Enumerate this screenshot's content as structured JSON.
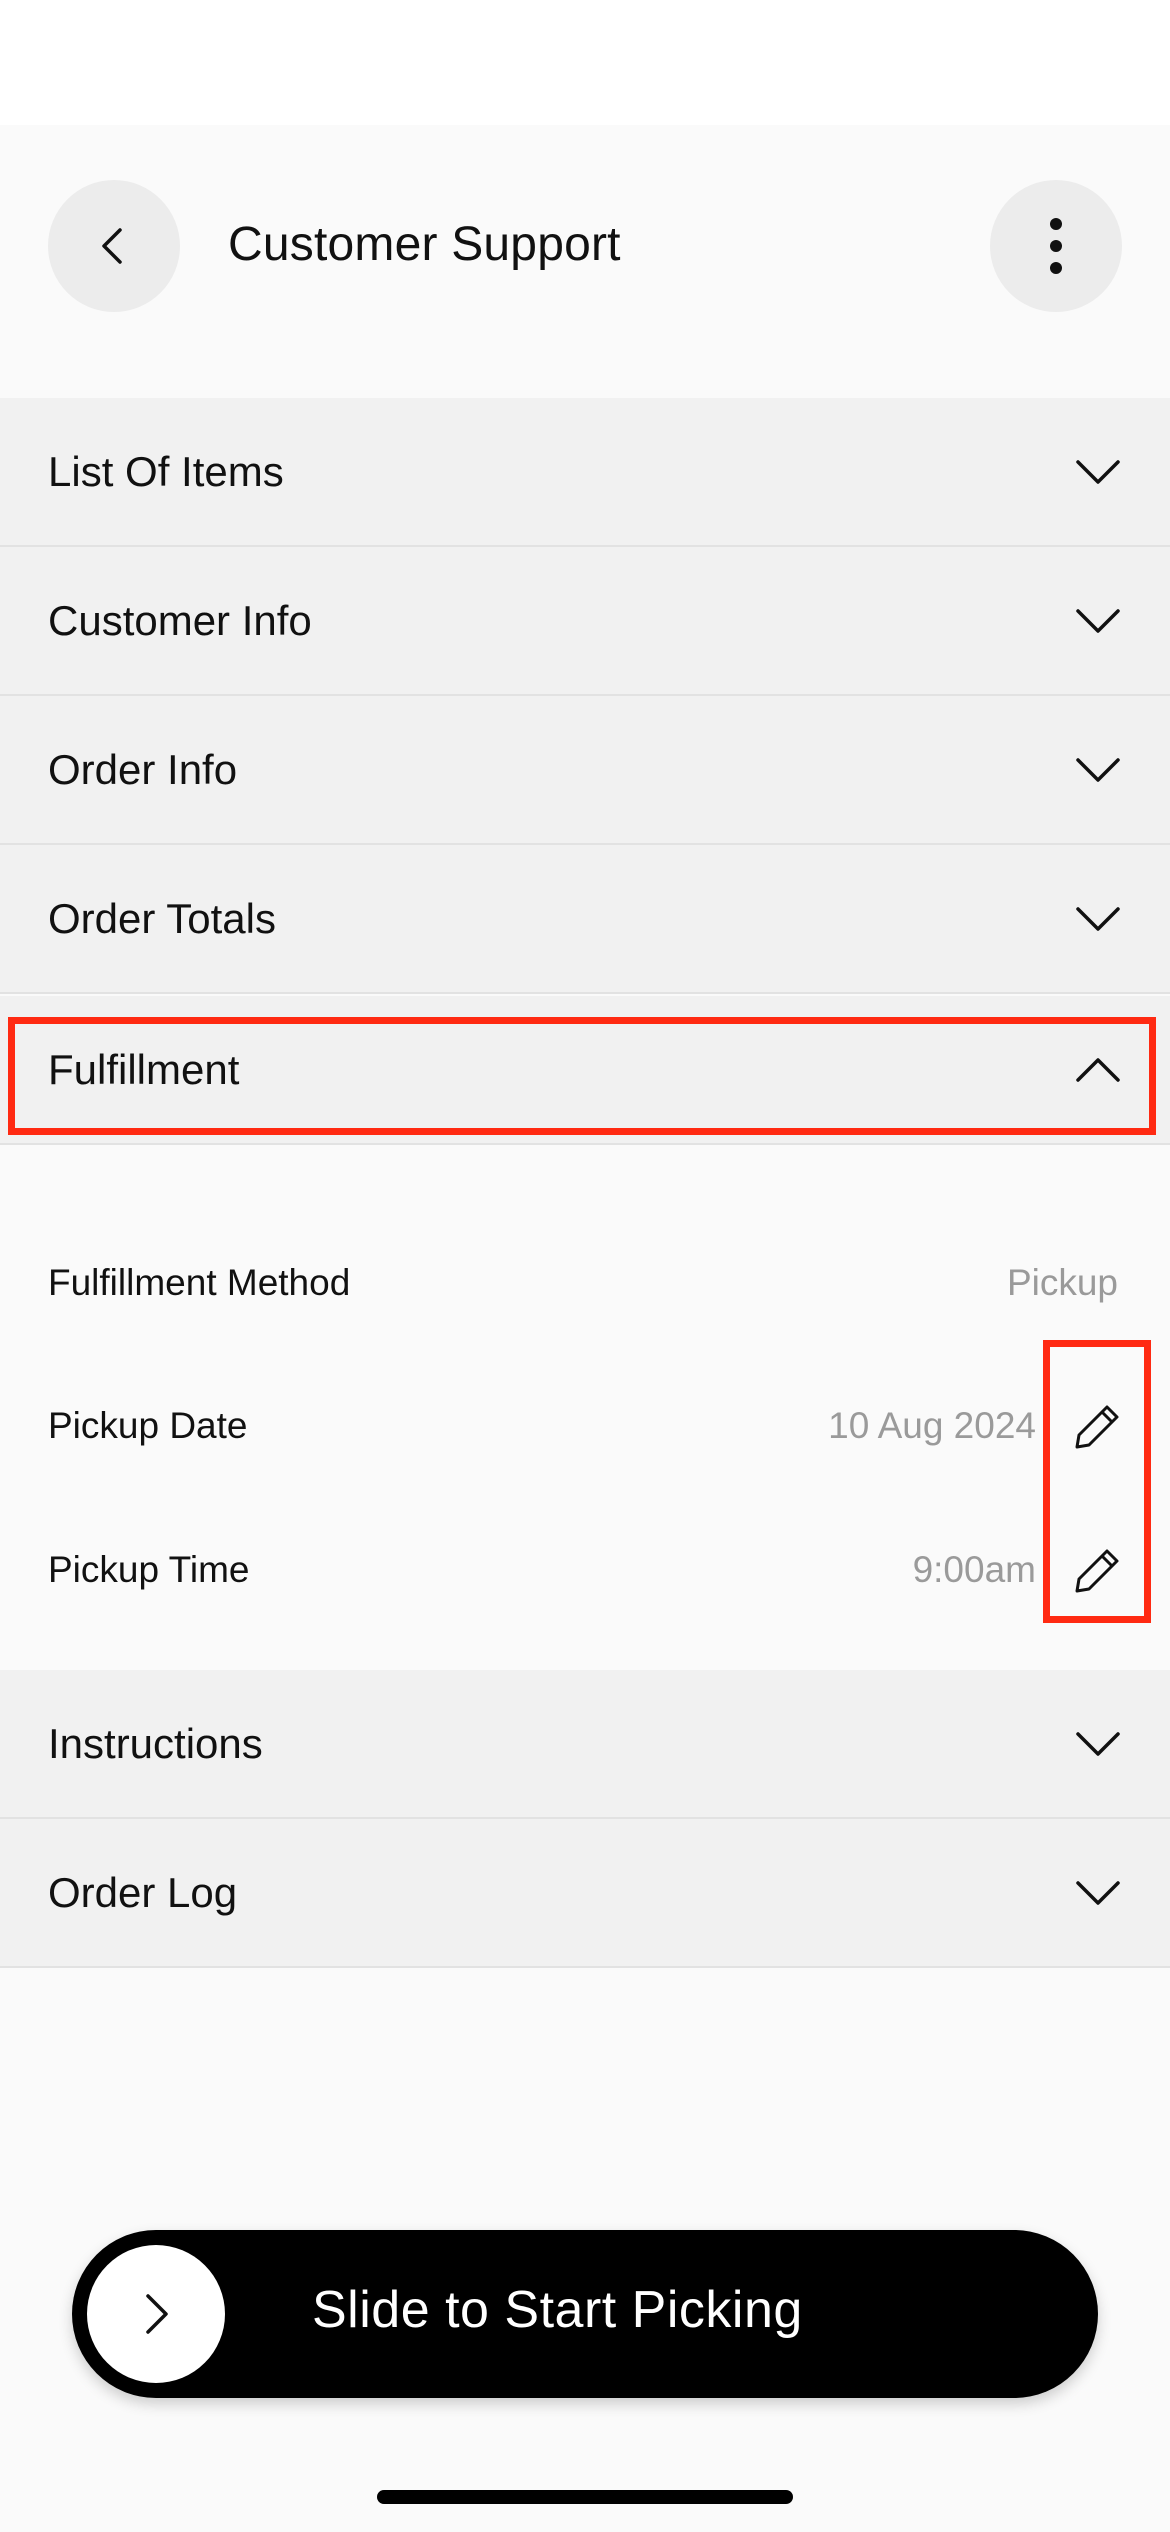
{
  "header": {
    "title": "Customer Support",
    "back_icon": "chevron-left-icon",
    "more_icon": "more-vertical-icon"
  },
  "sections": [
    {
      "label": "List Of Items",
      "state": "collapsed"
    },
    {
      "label": "Customer Info",
      "state": "collapsed"
    },
    {
      "label": "Order Info",
      "state": "collapsed"
    },
    {
      "label": "Order Totals",
      "state": "collapsed"
    },
    {
      "label": "Fulfillment",
      "state": "expanded"
    },
    {
      "label": "Instructions",
      "state": "collapsed"
    },
    {
      "label": "Order Log",
      "state": "collapsed"
    }
  ],
  "fulfillment": {
    "method_label": "Fulfillment Method",
    "method_value": "Pickup",
    "date_label": "Pickup Date",
    "date_value": "10 Aug 2024",
    "time_label": "Pickup Time",
    "time_value": "9:00am",
    "edit_icon": "pencil-icon"
  },
  "slider": {
    "label": "Slide to Start Picking",
    "knob_icon": "chevron-right-icon"
  },
  "colors": {
    "highlight": "#ff2a12",
    "row_background": "#f1f1f1",
    "value_text": "#9a9a9a",
    "slider_background": "#000000"
  }
}
